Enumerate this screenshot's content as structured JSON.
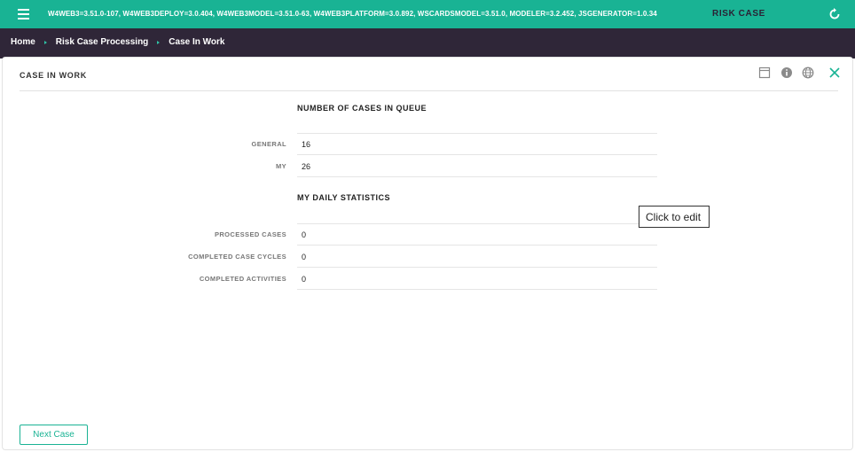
{
  "header": {
    "version": "W4WEB3=3.51.0-107, W4WEB3DEPLOY=3.0.404, W4WEB3MODEL=3.51.0-63, W4WEB3PLATFORM=3.0.892, WSCARDSMODEL=3.51.0, MODELER=3.2.452, JSGENERATOR=1.0.34",
    "app_title": "RISK CASE",
    "menu_icon": "hamburger-icon",
    "refresh_icon": "refresh-icon"
  },
  "breadcrumb": [
    {
      "label": "Home"
    },
    {
      "label": "Risk Case Processing"
    },
    {
      "label": "Case In Work"
    }
  ],
  "panel": {
    "title": "CASE IN WORK",
    "icons": [
      "window-icon",
      "info-icon",
      "globe-icon",
      "close-icon"
    ]
  },
  "queue": {
    "title": "NUMBER OF CASES IN QUEUE",
    "rows": [
      {
        "label": "GENERAL",
        "value": "16"
      },
      {
        "label": "MY",
        "value": "26"
      }
    ]
  },
  "daily": {
    "title": "MY DAILY STATISTICS",
    "rows": [
      {
        "label": "PROCESSED CASES",
        "value": "0"
      },
      {
        "label": "COMPLETED CASE CYCLES",
        "value": "0"
      },
      {
        "label": "COMPLETED ACTIVITIES",
        "value": "0"
      }
    ]
  },
  "tooltip": "Click to edit",
  "footer": {
    "next_label": "Next Case"
  },
  "colors": {
    "accent": "#1ab394",
    "breadcrumb_bg": "#2f2638"
  }
}
